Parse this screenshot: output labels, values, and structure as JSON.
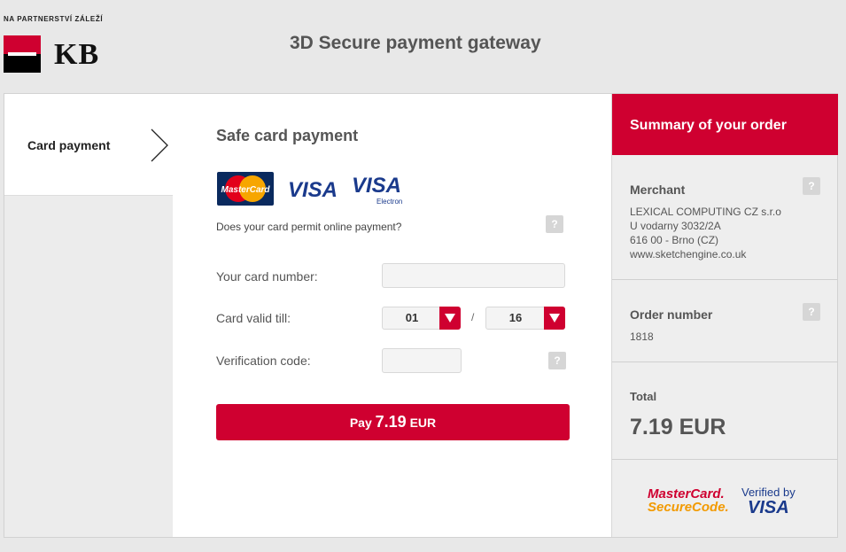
{
  "header": {
    "tagline": "NA PARTNERSTVÍ ZÁLEŽÍ",
    "logo_text": "KB",
    "title": "3D Secure payment gateway"
  },
  "nav": {
    "active_label": "Card payment"
  },
  "form": {
    "title": "Safe card payment",
    "card_logos": [
      "MasterCard",
      "VISA",
      "VISA Electron"
    ],
    "question": "Does your card permit online payment?",
    "help_label": "?",
    "card_number_label": "Your card number:",
    "card_number_value": "",
    "valid_label": "Card valid till:",
    "month_value": "01",
    "separator": "/",
    "year_value": "16",
    "cvc_label": "Verification code:",
    "cvc_value": "",
    "pay_prefix": "Pay",
    "pay_amount": "7.19",
    "pay_currency": "EUR"
  },
  "summary": {
    "title": "Summary of your order",
    "merchant_title": "Merchant",
    "merchant_lines": [
      "LEXICAL COMPUTING CZ s.r.o",
      "U vodarny 3032/2A",
      "616 00 - Brno (CZ)",
      "www.sketchengine.co.uk"
    ],
    "order_title": "Order number",
    "order_number": "1818",
    "total_title": "Total",
    "total_value": "7.19 EUR",
    "securecode_line1": "MasterCard.",
    "securecode_line2": "SecureCode.",
    "vbv_line1": "Verified by",
    "vbv_line2": "VISA"
  },
  "colors": {
    "brand_red": "#cf0030",
    "background": "#e8e8e8"
  },
  "icons": [
    "chevron-right-icon",
    "dropdown-arrow-icon",
    "help-icon"
  ]
}
